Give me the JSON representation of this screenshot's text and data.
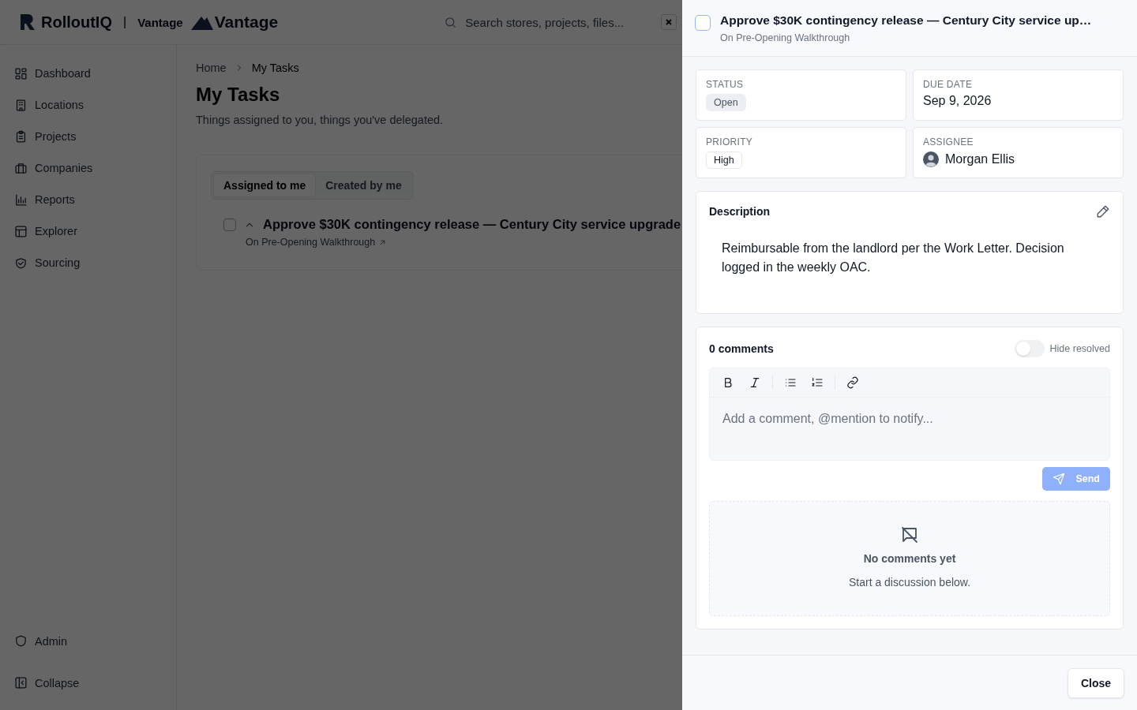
{
  "header": {
    "logo": "RolloutIQ",
    "divider": "|",
    "workspace": "Vantage",
    "brand": "Vantage",
    "search": {
      "placeholder": "Search stores, projects, files..."
    }
  },
  "sidebar": {
    "items": [
      {
        "label": "Dashboard"
      },
      {
        "label": "Locations"
      },
      {
        "label": "Projects"
      },
      {
        "label": "Companies"
      },
      {
        "label": "Reports"
      },
      {
        "label": "Explorer"
      },
      {
        "label": "Sourcing"
      }
    ],
    "footer": [
      {
        "label": "Admin"
      },
      {
        "label": "Collapse"
      }
    ]
  },
  "breadcrumb": [
    "Home",
    "My Tasks"
  ],
  "page": {
    "title": "My Tasks",
    "subtitle": "Things assigned to you, things you've delegated."
  },
  "tabs": [
    {
      "label": "Assigned to me",
      "selected": true
    },
    {
      "label": "Created by me",
      "selected": false
    }
  ],
  "tasks": [
    {
      "title": "Approve $30K contingency release — Century City service upgrade",
      "parent": "On Pre-Opening Walkthrough",
      "checked": false,
      "expanded": true
    }
  ],
  "drawer": {
    "task": {
      "title": "Approve $30K contingency release — Century City service up…",
      "parent": "On Pre-Opening Walkthrough",
      "checked": false
    },
    "fields": [
      {
        "label": "STATUS",
        "value": "Open",
        "kind": "badge"
      },
      {
        "label": "DUE DATE",
        "value": "Sep 9, 2026",
        "kind": "text"
      },
      {
        "label": "PRIORITY",
        "value": "High",
        "kind": "tag"
      },
      {
        "label": "ASSIGNEE",
        "value": "Morgan Ellis",
        "kind": "person"
      }
    ],
    "description": {
      "heading": "Description",
      "text": "Reimbursable from the landlord per the Work Letter. Decision logged in the weekly OAC."
    },
    "comments": {
      "count_label": "0 comments",
      "hide_resolved": {
        "label": "Hide resolved",
        "on": false
      },
      "editor": {
        "placeholder": "Add a comment, @mention to notify..."
      },
      "send": {
        "label": "Send",
        "disabled": true
      },
      "empty": {
        "title": "No comments yet",
        "text": "Start a discussion below."
      }
    },
    "close": "Close"
  }
}
